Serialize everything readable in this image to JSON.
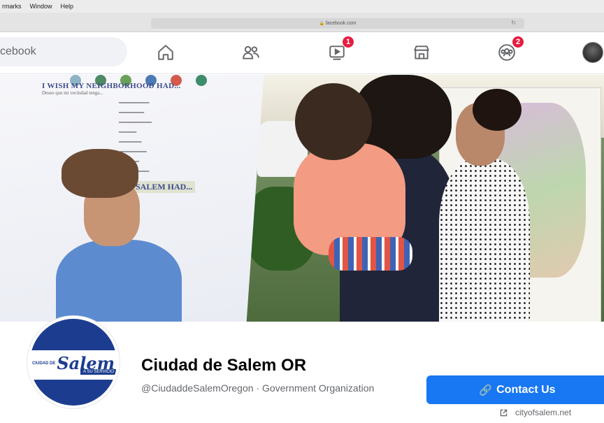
{
  "menubar": {
    "items": [
      "rmarks",
      "Window",
      "Help"
    ]
  },
  "browser": {
    "url": "facebook.com"
  },
  "fbnav": {
    "search_text": "cebook",
    "watch_badge": "1",
    "groups_badge": "2"
  },
  "page": {
    "name": "Ciudad de Salem OR",
    "handle_category": "@CiudaddeSalemOregon · Government Organization",
    "contact_label": "Contact Us",
    "website": "cityofsalem.net"
  },
  "logo": {
    "small_text": "CIUDAD DE",
    "script_text": "Salem",
    "tag_text": "A SU SERVICIO"
  },
  "cover_board": {
    "heading": "I WISH MY NEIGHBORHOOD HAD...",
    "subheading": "Deseo que mi vecindad tenga...",
    "heading2": "SALEM HAD..."
  },
  "colors": {
    "facebook_blue": "#1877f2",
    "badge_red": "#e41e3f",
    "logo_navy": "#1c3d8f"
  }
}
